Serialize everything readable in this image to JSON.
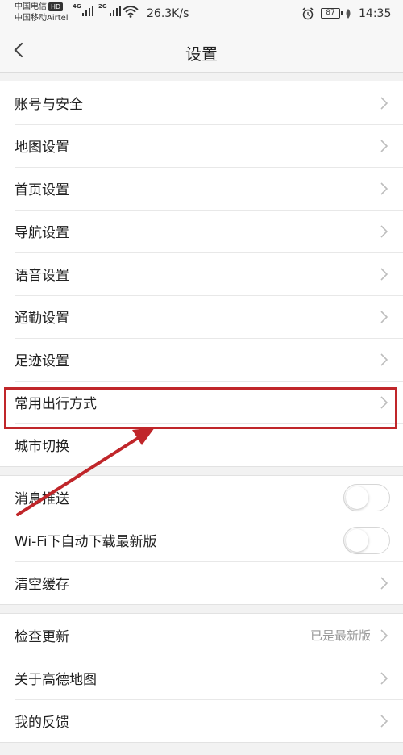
{
  "status_bar": {
    "carrier_1": "中国电信",
    "hd_badge": "HD",
    "carrier_2": "中国移动Airtel",
    "net_1": "4G",
    "net_2": "2G",
    "speed": "26.3K/s",
    "battery": "87",
    "time": "14:35"
  },
  "header": {
    "title": "设置"
  },
  "group_1": [
    {
      "label": "账号与安全"
    },
    {
      "label": "地图设置"
    },
    {
      "label": "首页设置"
    },
    {
      "label": "导航设置"
    },
    {
      "label": "语音设置"
    },
    {
      "label": "通勤设置"
    },
    {
      "label": "足迹设置"
    },
    {
      "label": "常用出行方式"
    },
    {
      "label": "城市切换"
    }
  ],
  "group_2": [
    {
      "label": "消息推送",
      "control": "toggle",
      "on": false
    },
    {
      "label": "Wi-Fi下自动下载最新版",
      "control": "toggle",
      "on": false
    },
    {
      "label": "清空缓存",
      "control": "chevron"
    }
  ],
  "group_3": [
    {
      "label": "检查更新",
      "value": "已是最新版"
    },
    {
      "label": "关于高德地图"
    },
    {
      "label": "我的反馈"
    }
  ],
  "colors": {
    "annotation_red": "#c0262a",
    "background": "#f2f2f2"
  }
}
